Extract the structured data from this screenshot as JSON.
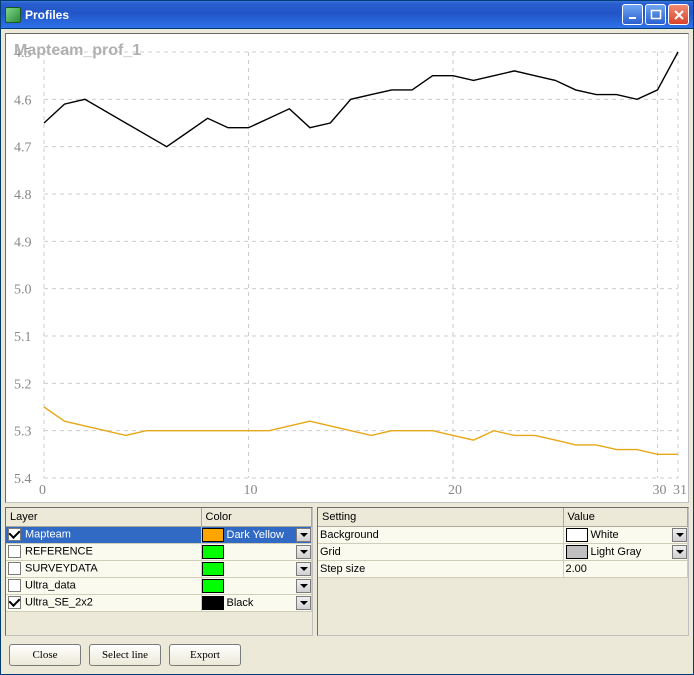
{
  "window": {
    "title": "Profiles"
  },
  "chart_data": {
    "type": "line",
    "title": "Mapteam_prof_1",
    "xlabel": "",
    "ylabel": "",
    "xlim": [
      0,
      31
    ],
    "ylim": [
      5.4,
      4.5
    ],
    "x_ticks": [
      0,
      10,
      20,
      30,
      31
    ],
    "y_ticks": [
      4.5,
      4.6,
      4.7,
      4.8,
      4.9,
      5.0,
      5.1,
      5.2,
      5.3,
      5.4
    ],
    "series": [
      {
        "name": "Mapteam",
        "color": "#e6a817",
        "x": [
          0,
          1,
          2,
          3,
          4,
          5,
          6,
          7,
          8,
          9,
          10,
          11,
          12,
          13,
          14,
          15,
          16,
          17,
          18,
          19,
          20,
          21,
          22,
          23,
          24,
          25,
          26,
          27,
          28,
          29,
          30,
          31
        ],
        "y": [
          5.25,
          5.28,
          5.29,
          5.3,
          5.31,
          5.3,
          5.3,
          5.3,
          5.3,
          5.3,
          5.3,
          5.3,
          5.29,
          5.28,
          5.29,
          5.3,
          5.31,
          5.3,
          5.3,
          5.3,
          5.31,
          5.32,
          5.3,
          5.31,
          5.31,
          5.32,
          5.33,
          5.33,
          5.34,
          5.34,
          5.35,
          5.35
        ]
      },
      {
        "name": "Ultra_SE_2x2",
        "color": "#000000",
        "x": [
          0,
          1,
          2,
          6,
          7,
          8,
          9,
          10,
          11,
          12,
          13,
          14,
          15,
          16,
          17,
          18,
          19,
          20,
          21,
          22,
          23,
          24,
          25,
          26,
          27,
          28,
          29,
          30,
          31
        ],
        "y": [
          4.65,
          4.61,
          4.6,
          4.7,
          4.67,
          4.64,
          4.66,
          4.66,
          4.64,
          4.62,
          4.66,
          4.65,
          4.6,
          4.59,
          4.58,
          4.58,
          4.55,
          4.55,
          4.56,
          4.55,
          4.54,
          4.55,
          4.56,
          4.58,
          4.59,
          4.59,
          4.6,
          4.58,
          4.5
        ]
      }
    ]
  },
  "layers": {
    "headers": {
      "layer": "Layer",
      "color": "Color"
    },
    "rows": [
      {
        "checked": true,
        "name": "Mapteam",
        "swatch": "#ffa500",
        "color_label": "Dark Yellow",
        "selected": true
      },
      {
        "checked": false,
        "name": "REFERENCE",
        "swatch": "#00ff00",
        "color_label": "",
        "selected": false
      },
      {
        "checked": false,
        "name": "SURVEYDATA",
        "swatch": "#00ff00",
        "color_label": "",
        "selected": false
      },
      {
        "checked": false,
        "name": "Ultra_data",
        "swatch": "#00ff00",
        "color_label": "",
        "selected": false
      },
      {
        "checked": true,
        "name": "Ultra_SE_2x2",
        "swatch": "#000000",
        "color_label": "Black",
        "selected": false
      }
    ]
  },
  "settings": {
    "headers": {
      "setting": "Setting",
      "value": "Value"
    },
    "rows": [
      {
        "name": "Background",
        "swatch": "#ffffff",
        "value_label": "White",
        "dropdown": true
      },
      {
        "name": "Grid",
        "swatch": "#c0c0c0",
        "value_label": "Light Gray",
        "dropdown": true
      },
      {
        "name": "Step size",
        "swatch": null,
        "value_label": "2.00",
        "dropdown": false
      }
    ]
  },
  "buttons": {
    "close": "Close",
    "select_line": "Select line",
    "export": "Export"
  }
}
